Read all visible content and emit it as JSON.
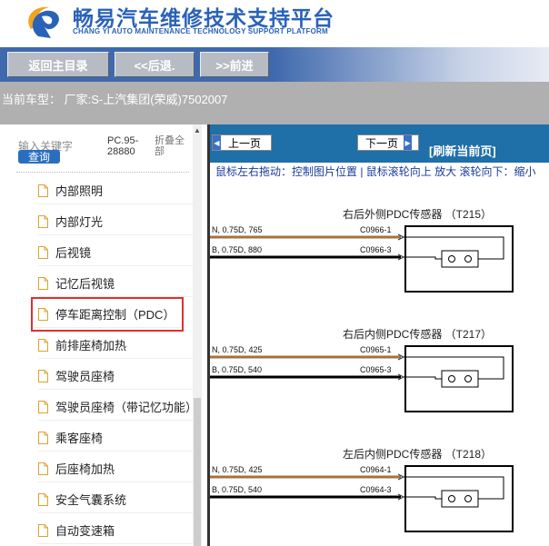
{
  "header": {
    "title": "畅易汽车维修技术支持平台",
    "subtitle": "CHANG YI AUTO MAINTENANCE TECHNOLOGY SUPPORT PLATFORM",
    "brand_color": "#2a62b8"
  },
  "nav": {
    "home_label": "返回主目录",
    "back_label": "<<后退.",
    "forward_label": ">>前进"
  },
  "model": {
    "text": "当前车型：  厂家:S-上汽集团(荣威)7502007"
  },
  "sidebar": {
    "search_label": "输入关键字",
    "search_button": "查询",
    "pc_label": "PC.95-28880",
    "fold_label": "折叠全部",
    "items": [
      {
        "label": "内部照明"
      },
      {
        "label": "内部灯光"
      },
      {
        "label": "后视镜"
      },
      {
        "label": "记忆后视镜"
      },
      {
        "label": "停车距离控制（PDC）"
      },
      {
        "label": "前排座椅加热"
      },
      {
        "label": "驾驶员座椅"
      },
      {
        "label": "驾驶员座椅（带记忆功能）"
      },
      {
        "label": "乘客座椅"
      },
      {
        "label": "后座椅加热"
      },
      {
        "label": "安全气囊系统"
      },
      {
        "label": "自动变速箱"
      }
    ],
    "selected_index": 4
  },
  "main": {
    "prev_label": "上一页",
    "next_label": "下一页",
    "refresh_label": "[刷新当前页]",
    "hint": "鼠标左右拖动：控制图片位置 | 鼠标滚轮向上 放大  滚轮向下：缩小",
    "diagrams": [
      {
        "title": "右后外侧PDC传感器  （T215）",
        "wire1": "N, 0.75D, 765",
        "conn1": "C0966-1",
        "wire2": "B, 0.75D, 880",
        "conn2": "C0966-3"
      },
      {
        "title": "右后内侧PDC传感器  （T217）",
        "wire1": "N, 0.75D, 425",
        "conn1": "C0965-1",
        "wire2": "B, 0.75D, 540",
        "conn2": "C0965-3"
      },
      {
        "title": "左后内侧PDC传感器  （T218）",
        "wire1": "N, 0.75D, 425",
        "conn1": "C0964-1",
        "wire2": "B, 0.75D, 540",
        "conn2": "C0964-3"
      }
    ],
    "wire_colors": {
      "brown": "#a5713e",
      "black": "#000000"
    }
  }
}
